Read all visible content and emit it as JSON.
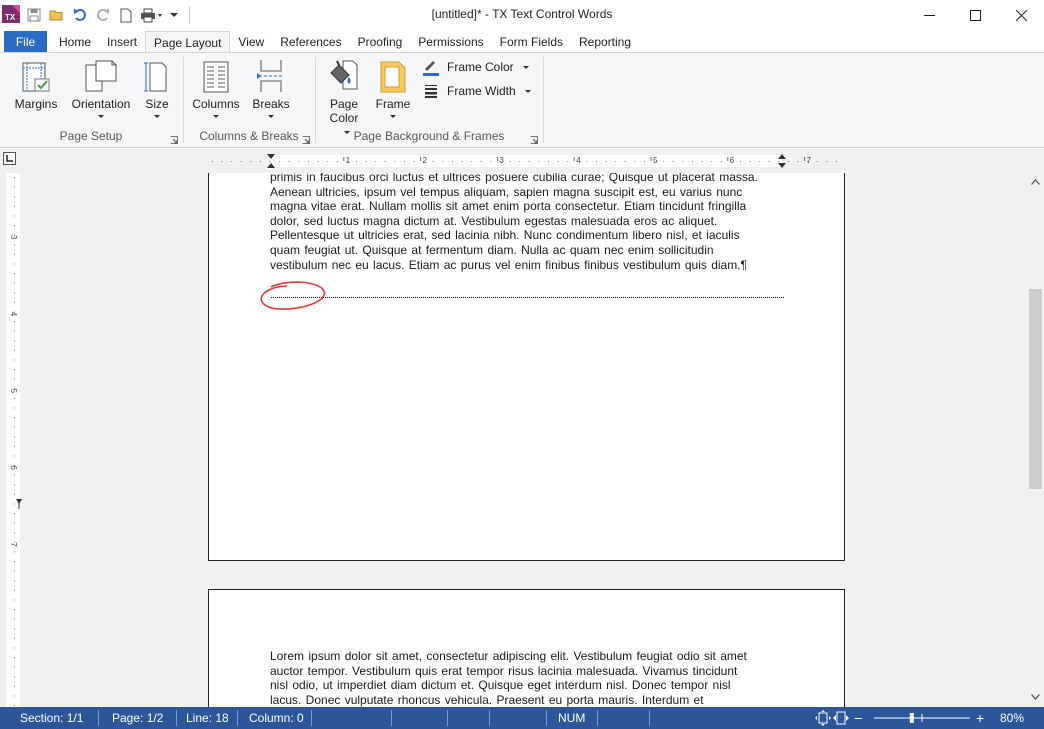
{
  "window": {
    "title": "[untitled]* - TX Text Control Words"
  },
  "quick_access": {
    "icons": [
      "save-icon",
      "open-folder-icon",
      "undo-icon",
      "redo-icon",
      "new-document-icon",
      "print-icon",
      "customize-icon"
    ]
  },
  "tabs": [
    {
      "label": "File"
    },
    {
      "label": "Home"
    },
    {
      "label": "Insert"
    },
    {
      "label": "Page Layout"
    },
    {
      "label": "View"
    },
    {
      "label": "References"
    },
    {
      "label": "Proofing"
    },
    {
      "label": "Permissions"
    },
    {
      "label": "Form Fields"
    },
    {
      "label": "Reporting"
    }
  ],
  "ribbon": {
    "page_setup": {
      "label": "Page Setup",
      "margins": "Margins",
      "orientation": "Orientation",
      "size": "Size"
    },
    "columns_breaks": {
      "label": "Columns & Breaks",
      "columns": "Columns",
      "breaks": "Breaks"
    },
    "background_frames": {
      "label": "Page Background & Frames",
      "page_color_1": "Page",
      "page_color_2": "Color",
      "frame": "Frame",
      "frame_color": "Frame Color",
      "frame_width": "Frame Width"
    }
  },
  "ruler": {
    "h_numbers": [
      "1",
      "2",
      "3",
      "4",
      "5",
      "6",
      "7"
    ],
    "v_numbers": [
      "3",
      "4",
      "5",
      "6",
      "7"
    ]
  },
  "document": {
    "page1_lines": [
      "primis in faucibus orci luctus et ultrices posuere cubilia curae; Quisque ut placerat massa.",
      "Aenean ultricies, ipsum vel tempus aliquam, sapien magna suscipit est, eu varius nunc",
      "magna vitae erat. Nullam mollis sit amet enim porta consectetur. Etiam tincidunt fringilla",
      "dolor, sed luctus magna dictum at. Vestibulum egestas malesuada eros ac aliquet.",
      "Pellentesque ut ultricies erat, sed lacinia nibh. Nunc condimentum libero nisl, et iaculis",
      "quam feugiat ut. Quisque at fermentum diam. Nulla ac quam nec enim sollicitudin",
      "vestibulum nec eu lacus. Etiam ac purus vel enim finibus finibus vestibulum quis diam.¶"
    ],
    "page2_lines": [
      "Lorem ipsum dolor sit amet, consectetur adipiscing elit. Vestibulum feugiat odio sit amet",
      "auctor tempor. Vestibulum quis erat tempor risus lacinia malesuada. Vivamus tincidunt",
      "nisl odio, ut imperdiet diam dictum et. Quisque eget interdum nisl. Donec tempor nisl",
      "lacus. Donec vulputate rhoncus vehicula. Praesent eu porta mauris. Interdum et"
    ]
  },
  "statusbar": {
    "section": "Section: 1/1",
    "page": "Page: 1/2",
    "line": "Line: 18",
    "column": "Column: 0",
    "num": "NUM",
    "zoom": "80%",
    "zoom_level": 0.8,
    "minus": "−",
    "plus": "+"
  },
  "colors": {
    "accent": "#2b6cc4",
    "statusbar": "#2b579a",
    "annotation": "#e53935"
  }
}
